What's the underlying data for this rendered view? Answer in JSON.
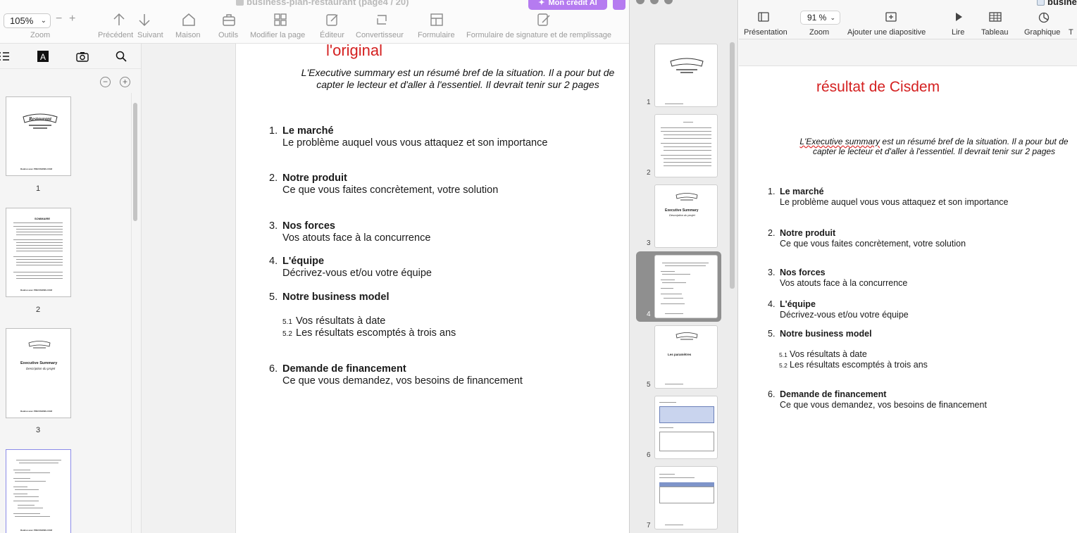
{
  "left_app": {
    "document_title": "business-plan-restaurant (page4 / 20)",
    "credit_button": "Mon crédit AI",
    "zoom": {
      "value": "105%",
      "label": "Zoom",
      "minus": "−",
      "plus": "+"
    },
    "toolbar": [
      {
        "label": "Précédent",
        "icon": "arrow-up-icon"
      },
      {
        "label": "Suivant",
        "icon": "arrow-down-icon"
      },
      {
        "label": "Maison",
        "icon": "home-icon"
      },
      {
        "label": "Outils",
        "icon": "toolbox-icon"
      },
      {
        "label": "Modifier la page",
        "icon": "grid-icon"
      },
      {
        "label": "Éditeur",
        "icon": "edit-icon"
      },
      {
        "label": "Convertisseur",
        "icon": "convert-icon"
      },
      {
        "label": "Formulaire",
        "icon": "form-icon"
      },
      {
        "label": "Formulaire de signature et de remplissage",
        "icon": "sign-icon"
      }
    ],
    "thumbnails": [
      {
        "page": "1",
        "footer": "Realisé avec PREVISIONS.COM",
        "banner": "Restaurant"
      },
      {
        "page": "2",
        "footer": "Realisé avec PREVISIONS.COM",
        "heading": "SOMMAIRE"
      },
      {
        "page": "3",
        "footer": "Realisé avec PREVISIONS.COM",
        "heading": "Executive Summary",
        "sub": "Description du projet"
      },
      {
        "page": "4",
        "footer": "Realisé avec PREVISIONS.COM"
      }
    ]
  },
  "document": {
    "label": "l'original",
    "summary_line1": "L'Executive summary  est un résumé bref de la situation. Il a pour but de",
    "summary_line2": "capter le lecteur et d'aller à l'essentiel. Il devrait tenir sur 2 pages",
    "sections": [
      {
        "num": "1.",
        "title": "Le marché",
        "desc": "Le problème auquel vous vous attaquez et son importance"
      },
      {
        "num": "2.",
        "title": "Notre produit",
        "desc": "Ce que vous faites concrètement, votre solution"
      },
      {
        "num": "3.",
        "title": "Nos forces",
        "desc": "Vos atouts face à la concurrence"
      },
      {
        "num": "4.",
        "title": "L'équipe",
        "desc": "Décrivez-vous et/ou votre équipe"
      },
      {
        "num": "5.",
        "title": "Notre business model",
        "desc": ""
      },
      {
        "num": "6.",
        "title": "Demande de financement",
        "desc": "Ce que vous demandez, vos besoins de financement"
      }
    ],
    "subsections": [
      {
        "num": "5.1",
        "text": "Vos résultats à date"
      },
      {
        "num": "5.2",
        "text": "Les résultats escomptés à trois ans"
      }
    ]
  },
  "right_app": {
    "window_title": "busine",
    "zoom_value": "91 %",
    "toolbar": [
      {
        "label": "Présentation",
        "icon": "presentation-icon"
      },
      {
        "label": "Zoom",
        "icon": ""
      },
      {
        "label": "Ajouter une diapositive",
        "icon": "add-slide-icon"
      },
      {
        "label": "Lire",
        "icon": "play-icon"
      },
      {
        "label": "Tableau",
        "icon": "table-icon"
      },
      {
        "label": "Graphique",
        "icon": "chart-icon"
      }
    ],
    "slides": [
      "1",
      "2",
      "3",
      "4",
      "5",
      "6",
      "7"
    ],
    "slide_texts": {
      "exec_title": "Executive Summary",
      "exec_sub": "Description du projet",
      "params": "Les paramètres"
    },
    "result_label": "résultat de Cisdem",
    "summary_underlined": "L'Executive summary",
    "summary_rest1": "  est un résumé bref de la situation. Il a pour but de",
    "summary_line2": "capter le lecteur et d'aller à l'essentiel. Il devrait tenir sur 2 pages"
  }
}
